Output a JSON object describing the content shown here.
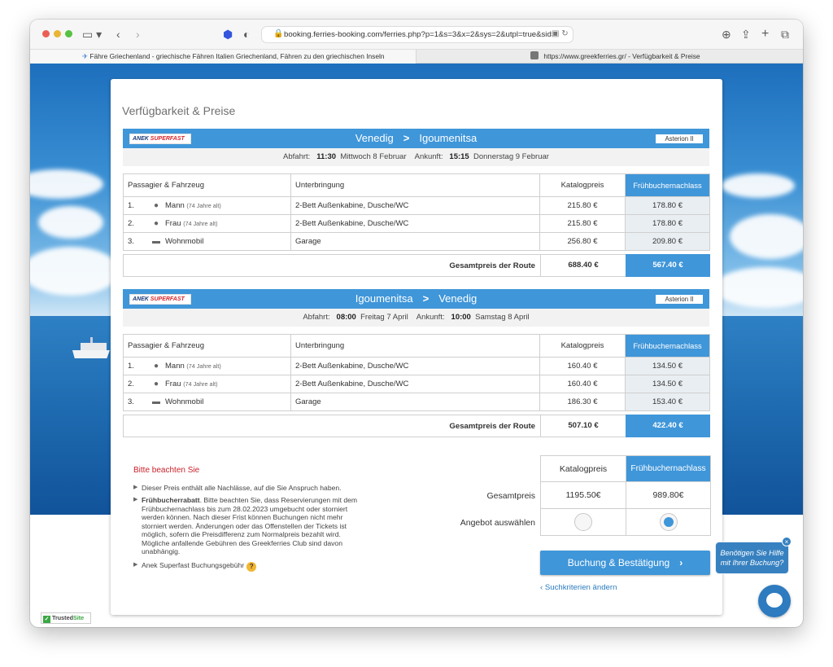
{
  "browser": {
    "url": "booking.ferries-booking.com/ferries.php?p=1&s=3&x=2&sys=2&utpl=true&sid=",
    "tabs": [
      {
        "label": "Fähre Griechenland - griechische Fähren Italien Griechenland, Fähren zu den griechischen Inseln",
        "active": true
      },
      {
        "label": "https://www.greekferries.gr/ - Verfügbarkeit & Preise",
        "active": false
      }
    ],
    "icons": [
      "sidebar-icon",
      "chevron-left-icon",
      "chevron-right-icon",
      "shield-icon",
      "lock-icon",
      "download-icon",
      "share-icon",
      "plus-icon",
      "tabs-overview-icon"
    ]
  },
  "page": {
    "title": "Verfügbarkeit & Preise",
    "columns": {
      "passenger": "Passagier & Fahrzeug",
      "accommodation": "Unterbringung",
      "catalog": "Katalogpreis",
      "early": "Frühbuchernachlass"
    },
    "total_label": "Gesamtpreis der Route",
    "brand": {
      "anek": "ANEK",
      "superfast": "SUPERFAST"
    },
    "accent_color": "#3f96d9",
    "alert_color": "#c8212a"
  },
  "routes": [
    {
      "from": "Venedig",
      "to": "Igoumenitsa",
      "vessel": "Asterion II",
      "dep_label": "Abfahrt:",
      "dep_time": "11:30",
      "dep_date": "Mittwoch 8 Februar",
      "arr_label": "Ankunft:",
      "arr_time": "15:15",
      "arr_date": "Donnerstag 9 Februar",
      "rows": [
        {
          "no": "1.",
          "name": "Mann",
          "age": "(74 Jahre alt)",
          "icon": "male-person-icon",
          "accommodation": "2-Bett Außenkabine, Dusche/WC",
          "catalog": "215.80 €",
          "early": "178.80 €"
        },
        {
          "no": "2.",
          "name": "Frau",
          "age": "(74 Jahre alt)",
          "icon": "female-person-icon",
          "accommodation": "2-Bett Außenkabine, Dusche/WC",
          "catalog": "215.80 €",
          "early": "178.80 €"
        },
        {
          "no": "3.",
          "name": "Wohnmobil",
          "age": "",
          "icon": "camper-van-icon",
          "accommodation": "Garage",
          "catalog": "256.80 €",
          "early": "209.80 €"
        }
      ],
      "total_catalog": "688.40 €",
      "total_early": "567.40 €"
    },
    {
      "from": "Igoumenitsa",
      "to": "Venedig",
      "vessel": "Asterion II",
      "dep_label": "Abfahrt:",
      "dep_time": "08:00",
      "dep_date": "Freitag 7 April",
      "arr_label": "Ankunft:",
      "arr_time": "10:00",
      "arr_date": "Samstag 8 April",
      "rows": [
        {
          "no": "1.",
          "name": "Mann",
          "age": "(74 Jahre alt)",
          "icon": "male-person-icon",
          "accommodation": "2-Bett Außenkabine, Dusche/WC",
          "catalog": "160.40 €",
          "early": "134.50 €"
        },
        {
          "no": "2.",
          "name": "Frau",
          "age": "(74 Jahre alt)",
          "icon": "female-person-icon",
          "accommodation": "2-Bett Außenkabine, Dusche/WC",
          "catalog": "160.40 €",
          "early": "134.50 €"
        },
        {
          "no": "3.",
          "name": "Wohnmobil",
          "age": "",
          "icon": "camper-van-icon",
          "accommodation": "Garage",
          "catalog": "186.30 €",
          "early": "153.40 €"
        }
      ],
      "total_catalog": "507.10 €",
      "total_early": "422.40 €"
    }
  ],
  "notes": {
    "title": "Bitte beachten Sie",
    "item1": "Dieser Preis enthält alle Nachlässe, auf die Sie Anspruch haben.",
    "item2_bold": "Frühbucherrabatt",
    "item2_lines": [
      ". Bitte beachten Sie, dass Reservierungen mit dem",
      "Frühbuchernachlass bis zum 28.02.2023 umgebucht oder storniert",
      "werden können. Nach dieser Frist können Buchungen nicht mehr",
      "storniert werden. Änderungen oder das Offenstellen der Tickets ist",
      "möglich, sofern die Preisdifferenz zum Normalpreis bezahlt wird.",
      "Mögliche anfallende Gebühren des Greekferries Club sind davon",
      "unabhängig."
    ],
    "item3": "Anek Superfast Buchungsgebühr",
    "help": "?"
  },
  "summary": {
    "catalog_label": "Katalogpreis",
    "early_label": "Frühbuchernachlass",
    "total_label": "Gesamtpreis",
    "catalog_total": "1195.50€",
    "early_total": "989.80€",
    "select_label": "Angebot auswählen",
    "selected": "early"
  },
  "actions": {
    "book": "Buchung & Bestätigung",
    "book_chevron": "›",
    "back": "Suchkriterien ändern",
    "back_chevron": "‹"
  },
  "chat": {
    "line1": "Benötigen Sie Hilfe",
    "line2": "mit Ihrer Buchung?",
    "close": "×"
  },
  "trusted": {
    "prefix": "Trusted",
    "suffix": "Site"
  }
}
